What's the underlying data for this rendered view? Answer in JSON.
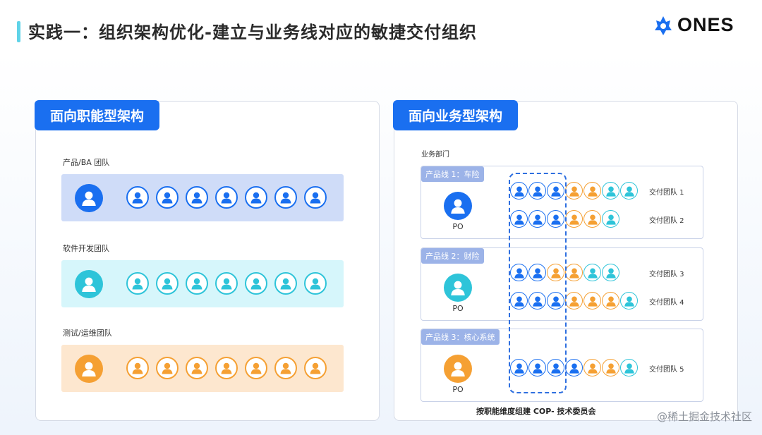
{
  "title": "实践一：组织架构优化-建立与业务线对应的敏捷交付组织",
  "logo_text": "ONES",
  "colors": {
    "blue": "#1a6ff0",
    "cyan": "#2ec4d9",
    "orange": "#f5a033",
    "accent": "#5fd3e8"
  },
  "left": {
    "tag": "面向职能型架构",
    "teams": [
      {
        "label": "产品/BA 团队",
        "color": "blue"
      },
      {
        "label": "软件开发团队",
        "color": "cyan"
      },
      {
        "label": "测试/运维团队",
        "color": "orange"
      }
    ]
  },
  "right": {
    "tag": "面向业务型架构",
    "dept": "业务部门",
    "product_lines": [
      {
        "tag": "产品线 1：车险",
        "po": "PO",
        "po_color": "blue",
        "rows": [
          {
            "label": "交付团队 1",
            "avatars": [
              "blue",
              "blue",
              "blue",
              "orange",
              "orange",
              "cyan",
              "cyan"
            ]
          },
          {
            "label": "交付团队 2",
            "avatars": [
              "blue",
              "blue",
              "blue",
              "orange",
              "orange",
              "cyan"
            ]
          }
        ]
      },
      {
        "tag": "产品线 2：财险",
        "po": "PO",
        "po_color": "cyan",
        "rows": [
          {
            "label": "交付团队 3",
            "avatars": [
              "blue",
              "blue",
              "orange",
              "orange",
              "cyan",
              "cyan"
            ]
          },
          {
            "label": "交付团队 4",
            "avatars": [
              "blue",
              "blue",
              "blue",
              "orange",
              "orange",
              "orange",
              "cyan"
            ]
          }
        ]
      },
      {
        "tag": "产品线 3：核心系统",
        "po": "PO",
        "po_color": "orange",
        "rows": [
          {
            "label": "交付团队 5",
            "avatars": [
              "blue",
              "blue",
              "blue",
              "blue",
              "orange",
              "orange",
              "cyan"
            ]
          }
        ]
      }
    ],
    "cop": "按职能维度组建 COP- 技术委员会"
  },
  "watermark": "@稀土掘金技术社区"
}
